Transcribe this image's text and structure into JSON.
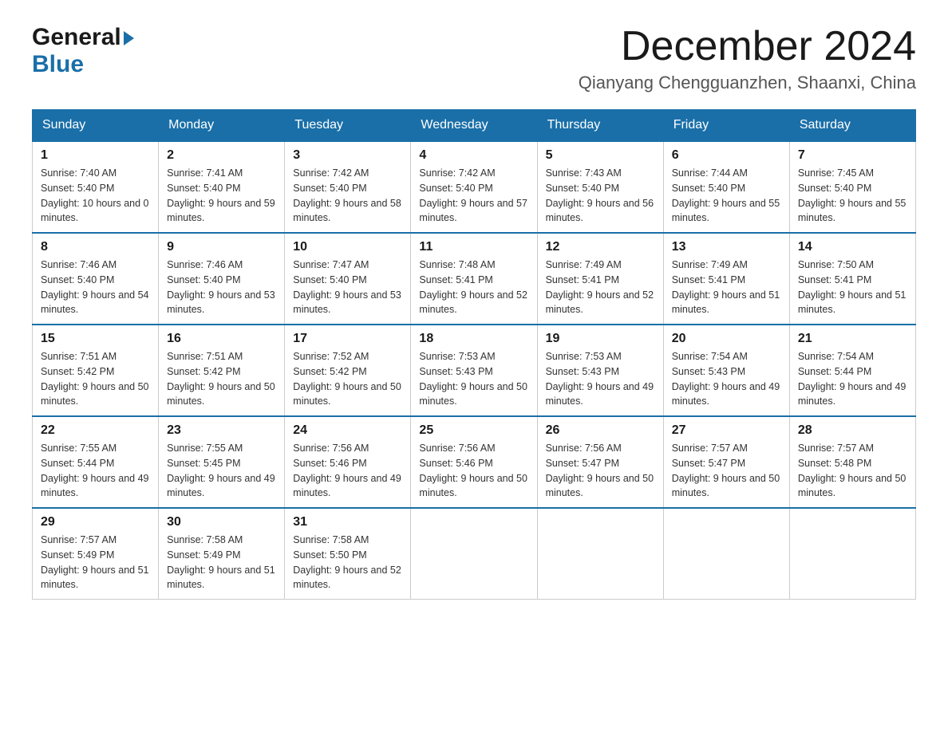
{
  "header": {
    "logo_general": "General",
    "logo_blue": "Blue",
    "month_title": "December 2024",
    "location": "Qianyang Chengguanzhen, Shaanxi, China"
  },
  "calendar": {
    "weekdays": [
      "Sunday",
      "Monday",
      "Tuesday",
      "Wednesday",
      "Thursday",
      "Friday",
      "Saturday"
    ],
    "weeks": [
      [
        {
          "day": "1",
          "sunrise": "7:40 AM",
          "sunset": "5:40 PM",
          "daylight": "10 hours and 0 minutes."
        },
        {
          "day": "2",
          "sunrise": "7:41 AM",
          "sunset": "5:40 PM",
          "daylight": "9 hours and 59 minutes."
        },
        {
          "day": "3",
          "sunrise": "7:42 AM",
          "sunset": "5:40 PM",
          "daylight": "9 hours and 58 minutes."
        },
        {
          "day": "4",
          "sunrise": "7:42 AM",
          "sunset": "5:40 PM",
          "daylight": "9 hours and 57 minutes."
        },
        {
          "day": "5",
          "sunrise": "7:43 AM",
          "sunset": "5:40 PM",
          "daylight": "9 hours and 56 minutes."
        },
        {
          "day": "6",
          "sunrise": "7:44 AM",
          "sunset": "5:40 PM",
          "daylight": "9 hours and 55 minutes."
        },
        {
          "day": "7",
          "sunrise": "7:45 AM",
          "sunset": "5:40 PM",
          "daylight": "9 hours and 55 minutes."
        }
      ],
      [
        {
          "day": "8",
          "sunrise": "7:46 AM",
          "sunset": "5:40 PM",
          "daylight": "9 hours and 54 minutes."
        },
        {
          "day": "9",
          "sunrise": "7:46 AM",
          "sunset": "5:40 PM",
          "daylight": "9 hours and 53 minutes."
        },
        {
          "day": "10",
          "sunrise": "7:47 AM",
          "sunset": "5:40 PM",
          "daylight": "9 hours and 53 minutes."
        },
        {
          "day": "11",
          "sunrise": "7:48 AM",
          "sunset": "5:41 PM",
          "daylight": "9 hours and 52 minutes."
        },
        {
          "day": "12",
          "sunrise": "7:49 AM",
          "sunset": "5:41 PM",
          "daylight": "9 hours and 52 minutes."
        },
        {
          "day": "13",
          "sunrise": "7:49 AM",
          "sunset": "5:41 PM",
          "daylight": "9 hours and 51 minutes."
        },
        {
          "day": "14",
          "sunrise": "7:50 AM",
          "sunset": "5:41 PM",
          "daylight": "9 hours and 51 minutes."
        }
      ],
      [
        {
          "day": "15",
          "sunrise": "7:51 AM",
          "sunset": "5:42 PM",
          "daylight": "9 hours and 50 minutes."
        },
        {
          "day": "16",
          "sunrise": "7:51 AM",
          "sunset": "5:42 PM",
          "daylight": "9 hours and 50 minutes."
        },
        {
          "day": "17",
          "sunrise": "7:52 AM",
          "sunset": "5:42 PM",
          "daylight": "9 hours and 50 minutes."
        },
        {
          "day": "18",
          "sunrise": "7:53 AM",
          "sunset": "5:43 PM",
          "daylight": "9 hours and 50 minutes."
        },
        {
          "day": "19",
          "sunrise": "7:53 AM",
          "sunset": "5:43 PM",
          "daylight": "9 hours and 49 minutes."
        },
        {
          "day": "20",
          "sunrise": "7:54 AM",
          "sunset": "5:43 PM",
          "daylight": "9 hours and 49 minutes."
        },
        {
          "day": "21",
          "sunrise": "7:54 AM",
          "sunset": "5:44 PM",
          "daylight": "9 hours and 49 minutes."
        }
      ],
      [
        {
          "day": "22",
          "sunrise": "7:55 AM",
          "sunset": "5:44 PM",
          "daylight": "9 hours and 49 minutes."
        },
        {
          "day": "23",
          "sunrise": "7:55 AM",
          "sunset": "5:45 PM",
          "daylight": "9 hours and 49 minutes."
        },
        {
          "day": "24",
          "sunrise": "7:56 AM",
          "sunset": "5:46 PM",
          "daylight": "9 hours and 49 minutes."
        },
        {
          "day": "25",
          "sunrise": "7:56 AM",
          "sunset": "5:46 PM",
          "daylight": "9 hours and 50 minutes."
        },
        {
          "day": "26",
          "sunrise": "7:56 AM",
          "sunset": "5:47 PM",
          "daylight": "9 hours and 50 minutes."
        },
        {
          "day": "27",
          "sunrise": "7:57 AM",
          "sunset": "5:47 PM",
          "daylight": "9 hours and 50 minutes."
        },
        {
          "day": "28",
          "sunrise": "7:57 AM",
          "sunset": "5:48 PM",
          "daylight": "9 hours and 50 minutes."
        }
      ],
      [
        {
          "day": "29",
          "sunrise": "7:57 AM",
          "sunset": "5:49 PM",
          "daylight": "9 hours and 51 minutes."
        },
        {
          "day": "30",
          "sunrise": "7:58 AM",
          "sunset": "5:49 PM",
          "daylight": "9 hours and 51 minutes."
        },
        {
          "day": "31",
          "sunrise": "7:58 AM",
          "sunset": "5:50 PM",
          "daylight": "9 hours and 52 minutes."
        },
        null,
        null,
        null,
        null
      ]
    ]
  }
}
